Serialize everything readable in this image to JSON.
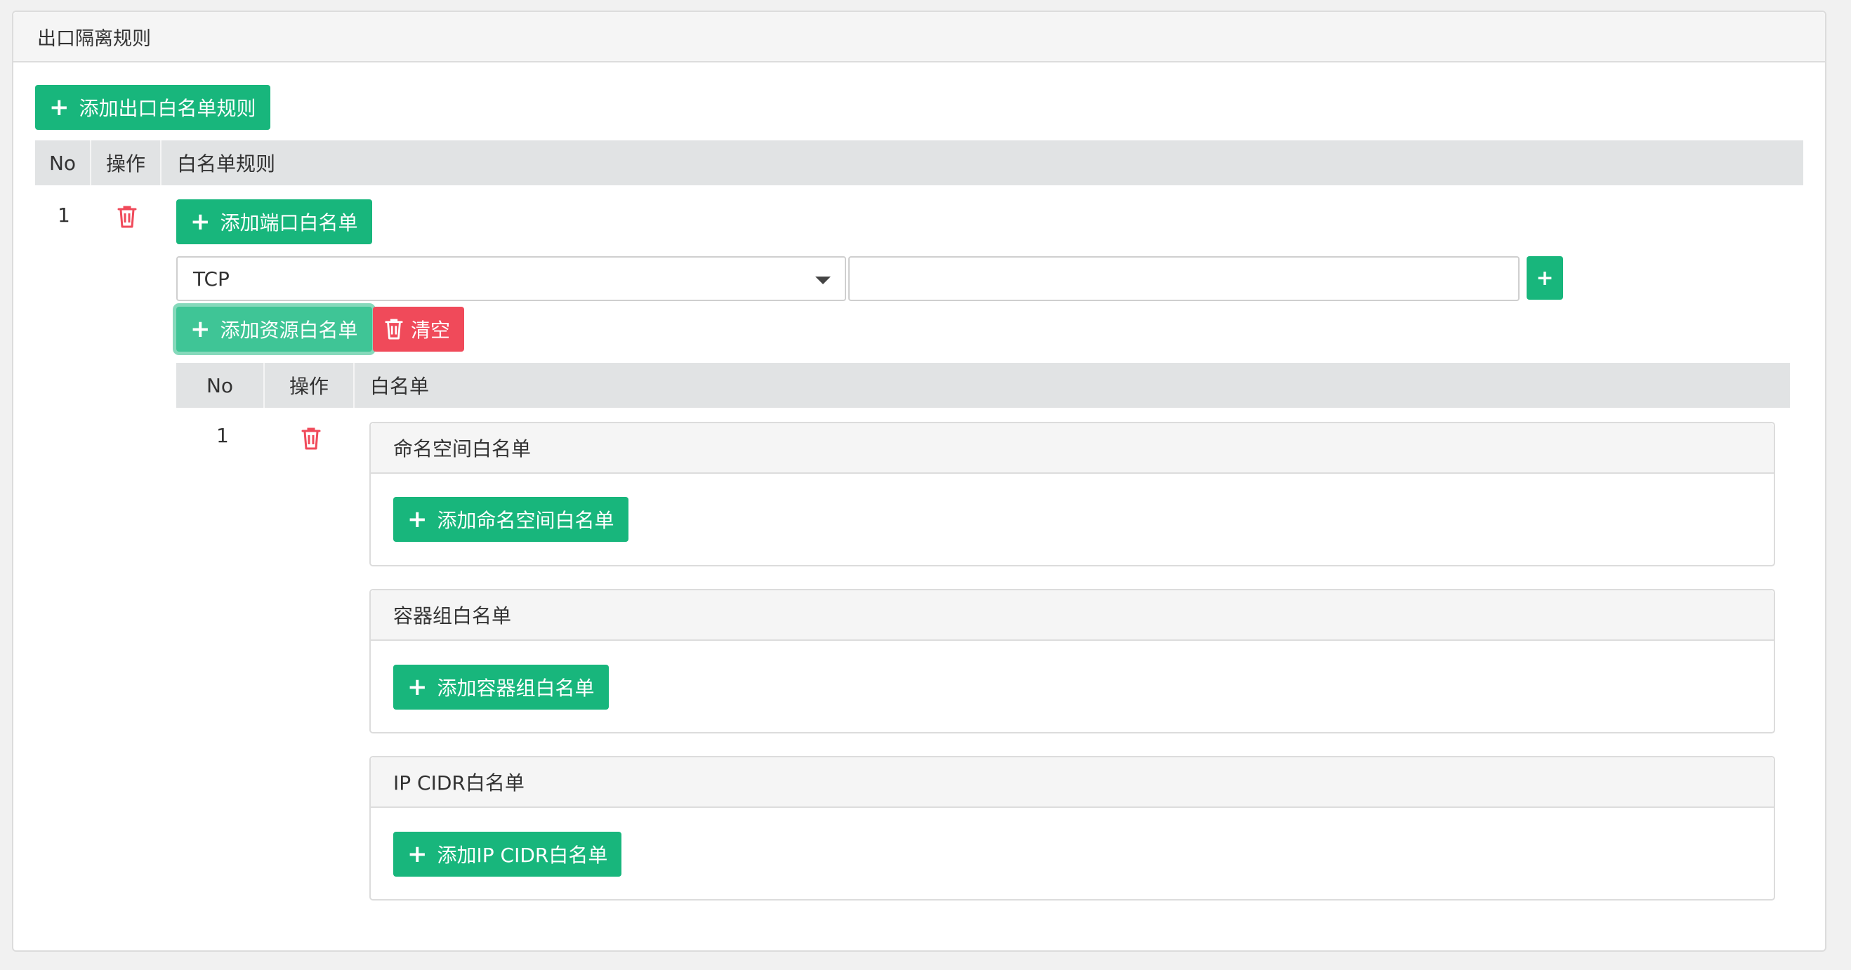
{
  "panel": {
    "title": "出口隔离规则"
  },
  "add_rule_button": {
    "label": "添加出口白名单规则",
    "icon": "plus-icon"
  },
  "rules_table": {
    "headers": [
      "No",
      "操作",
      "白名单规则"
    ],
    "rows": [
      {
        "no": "1",
        "delete_icon": "trash-icon",
        "add_port_button": "添加端口白名单",
        "protocol_select": {
          "value": "TCP",
          "options": [
            "TCP"
          ]
        },
        "port_input": {
          "value": "",
          "placeholder": ""
        },
        "add_port_plus": "+",
        "add_resource_button": "添加资源白名单",
        "clear_button": "清空",
        "resource_table": {
          "headers": [
            "No",
            "操作",
            "白名单"
          ],
          "rows": [
            {
              "no": "1",
              "delete_icon": "trash-icon",
              "sections": [
                {
                  "title": "命名空间白名单",
                  "button": "添加命名空间白名单"
                },
                {
                  "title": "容器组白名单",
                  "button": "添加容器组白名单"
                },
                {
                  "title": "IP CIDR白名单",
                  "button": "添加IP CIDR白名单"
                }
              ]
            }
          ]
        }
      }
    ]
  },
  "colors": {
    "primary": "#18b67c",
    "danger": "#f04a5a",
    "header_bg": "#e1e3e4"
  }
}
